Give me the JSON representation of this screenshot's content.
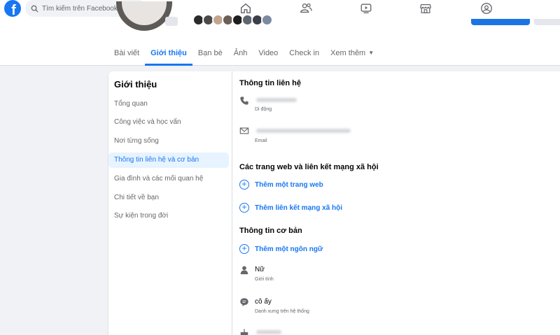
{
  "search": {
    "placeholder": "Tìm kiếm trên Facebook"
  },
  "nav": {
    "icons": [
      "home-icon",
      "friends-icon",
      "watch-icon",
      "marketplace-icon",
      "groups-icon"
    ]
  },
  "logo": "f",
  "tabs": [
    {
      "label": "Bài viết"
    },
    {
      "label": "Giới thiệu"
    },
    {
      "label": "Bạn bè"
    },
    {
      "label": "Ảnh"
    },
    {
      "label": "Video"
    },
    {
      "label": "Check in"
    },
    {
      "label": "Xem thêm"
    }
  ],
  "about": {
    "title": "Giới thiệu",
    "menu": [
      {
        "label": "Tổng quan"
      },
      {
        "label": "Công việc và học vấn"
      },
      {
        "label": "Nơi từng sống"
      },
      {
        "label": "Thông tin liên hệ và cơ bản"
      },
      {
        "label": "Gia đình và các mối quan hệ"
      },
      {
        "label": "Chi tiết về bạn"
      },
      {
        "label": "Sự kiện trong đời"
      }
    ]
  },
  "contact": {
    "title": "Thông tin liên hệ",
    "phone_label": "Di động",
    "email_label": "Email"
  },
  "websites": {
    "title": "Các trang web và liên kết mạng xã hội",
    "add_website": "Thêm một trang web",
    "add_social": "Thêm liên kết mạng xã hội"
  },
  "basic": {
    "title": "Thông tin cơ bản",
    "add_language": "Thêm một ngôn ngữ",
    "gender_value": "Nữ",
    "gender_label": "Giới tính",
    "pronoun_value": "cô ấy",
    "pronoun_label": "Danh xưng trên hệ thống"
  },
  "colors": {
    "accent": "#1877f2",
    "page_bg": "#f0f2f5",
    "active_bg": "#e7f3ff"
  }
}
